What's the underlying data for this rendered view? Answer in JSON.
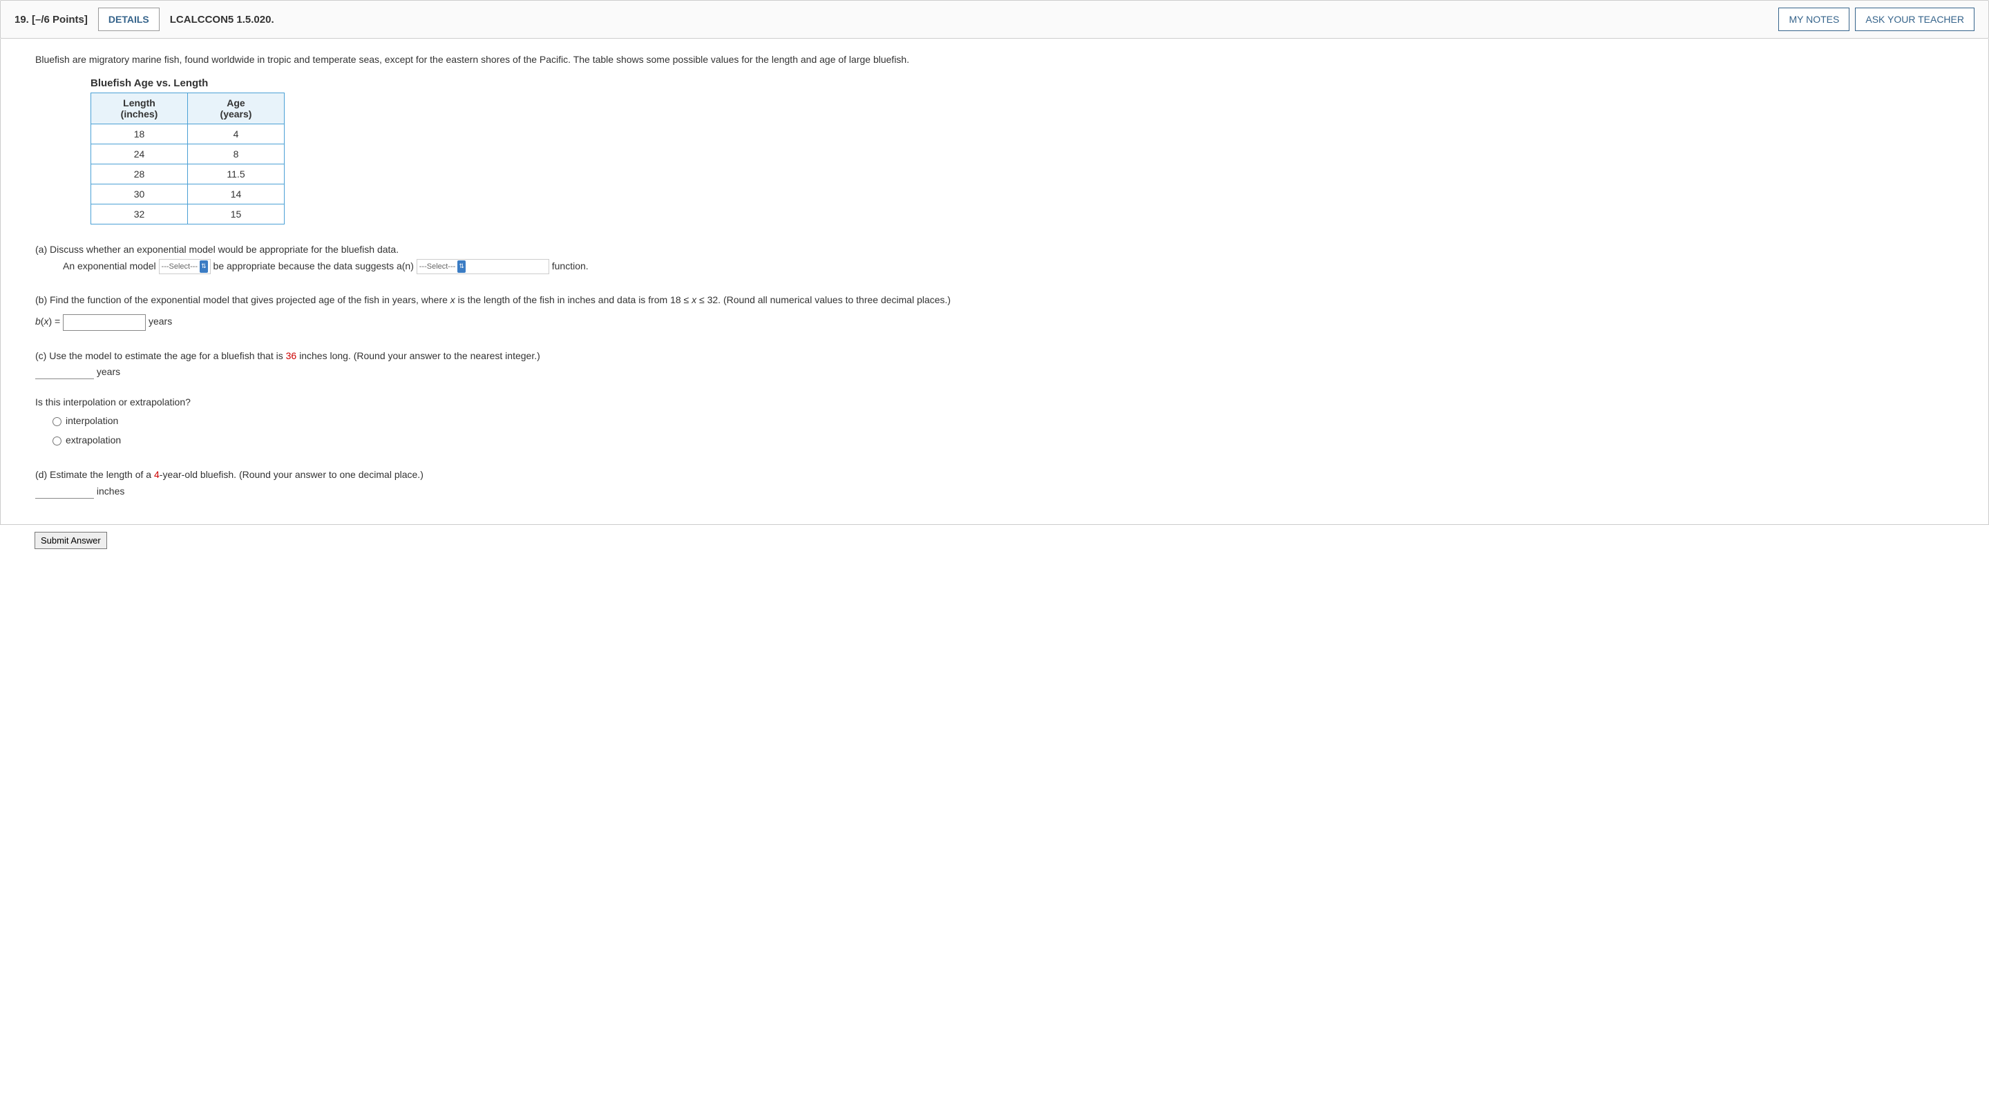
{
  "header": {
    "number": "19.",
    "points": "[–/6 Points]",
    "details_btn": "DETAILS",
    "book_ref": "LCALCCON5 1.5.020.",
    "my_notes": "MY NOTES",
    "ask_teacher": "ASK YOUR TEACHER"
  },
  "intro": "Bluefish are migratory marine fish, found worldwide in tropic and temperate seas, except for the eastern shores of the Pacific. The table shows some possible values for the length and age of large bluefish.",
  "table": {
    "title": "Bluefish Age vs. Length",
    "col1_l1": "Length",
    "col1_l2": "(inches)",
    "col2_l1": "Age",
    "col2_l2": "(years)",
    "rows": [
      {
        "length": "18",
        "age": "4"
      },
      {
        "length": "24",
        "age": "8"
      },
      {
        "length": "28",
        "age": "11.5"
      },
      {
        "length": "30",
        "age": "14"
      },
      {
        "length": "32",
        "age": "15"
      }
    ]
  },
  "part_a": {
    "prompt": "(a) Discuss whether an exponential model would be appropriate for the bluefish data.",
    "text1": "An exponential model",
    "select1": "---Select---",
    "text2": "be appropriate because the data suggests a(n)",
    "select2": "---Select---",
    "text3": "function."
  },
  "part_b": {
    "prompt_pre": "(b) Find the function of the exponential model that gives projected age of the fish in years, where ",
    "x_var": "x",
    "prompt_mid": " is the length of the fish in inches and data is from  18 ≤ ",
    "x_var2": "x",
    "prompt_post": " ≤ 32.  (Round all numerical values to three decimal places.)",
    "bx": "b",
    "bxparen": "(",
    "bx_x": "x",
    "bxclose": ") = ",
    "unit": "years"
  },
  "part_c": {
    "prompt_pre": "(c) Use the model to estimate the age for a bluefish that is ",
    "value": "36",
    "prompt_post": " inches long. (Round your answer to the nearest integer.)",
    "unit": "years",
    "sub_q": "Is this interpolation or extrapolation?",
    "opt1": "interpolation",
    "opt2": "extrapolation"
  },
  "part_d": {
    "prompt_pre": "(d) Estimate the length of a ",
    "value": "4",
    "prompt_post": "-year-old bluefish. (Round your answer to one decimal place.)",
    "unit": "inches"
  },
  "submit": "Submit Answer"
}
